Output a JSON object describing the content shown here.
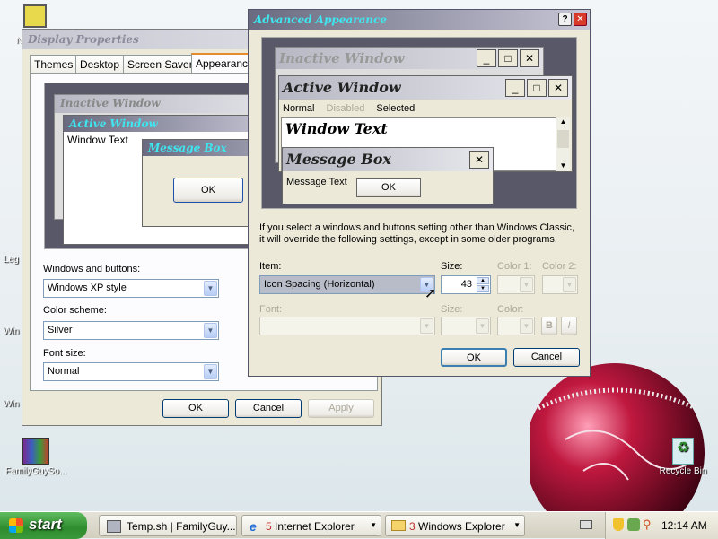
{
  "desktop": {
    "icons": [
      {
        "label": "FamilyGuySo..."
      },
      {
        "label": "Recycle Bin"
      }
    ],
    "partial_labels": [
      "N",
      "Leg",
      "Win",
      "Win"
    ]
  },
  "display_properties": {
    "title": "Display Properties",
    "tabs": [
      "Themes",
      "Desktop",
      "Screen Saver",
      "Appearance"
    ],
    "preview": {
      "inactive_title": "Inactive Window",
      "active_title": "Active Window",
      "window_text": "Window Text",
      "msgbox_title": "Message Box",
      "ok_label": "OK"
    },
    "windows_buttons_label": "Windows and buttons:",
    "windows_buttons_value": "Windows XP style",
    "color_scheme_label": "Color scheme:",
    "color_scheme_value": "Silver",
    "font_size_label": "Font size:",
    "font_size_value": "Normal",
    "ok_label": "OK",
    "cancel_label": "Cancel",
    "apply_label": "Apply"
  },
  "advanced_appearance": {
    "title": "Advanced Appearance",
    "help_label": "?",
    "close_label": "✕",
    "preview": {
      "inactive_title": "Inactive Window",
      "active_title": "Active Window",
      "menu_normal": "Normal",
      "menu_disabled": "Disabled",
      "menu_selected": "Selected",
      "window_text": "Window Text",
      "msgbox_title": "Message Box",
      "msgbox_text": "Message Text",
      "ok_label": "OK"
    },
    "info_text_1": "If you select a windows and buttons setting other than Windows Classic,",
    "info_text_2": "it will override the following settings, except in some older programs.",
    "item_label": "Item:",
    "item_value": "Icon Spacing (Horizontal)",
    "size_label": "Size:",
    "size_value": "43",
    "color1_label": "Color 1:",
    "color2_label": "Color 2:",
    "font_label": "Font:",
    "font_size_label": "Size:",
    "color_label": "Color:",
    "bold_label": "B",
    "italic_label": "I",
    "ok_label": "OK",
    "cancel_label": "Cancel"
  },
  "taskbar": {
    "start_label": "start",
    "buttons": [
      {
        "label": "Temp.sh | FamilyGuy..."
      },
      {
        "count": "5",
        "label": "Internet Explorer"
      },
      {
        "count": "3",
        "label": "Windows Explorer"
      }
    ],
    "clock": "12:14 AM"
  },
  "colors": {
    "title_active": "#6f6f86",
    "title_gradient_end": "#c8c8d8",
    "title_text_cyan": "#3ee6f0",
    "start_green": "#3a9a3a",
    "ok_border": "#003c74"
  }
}
